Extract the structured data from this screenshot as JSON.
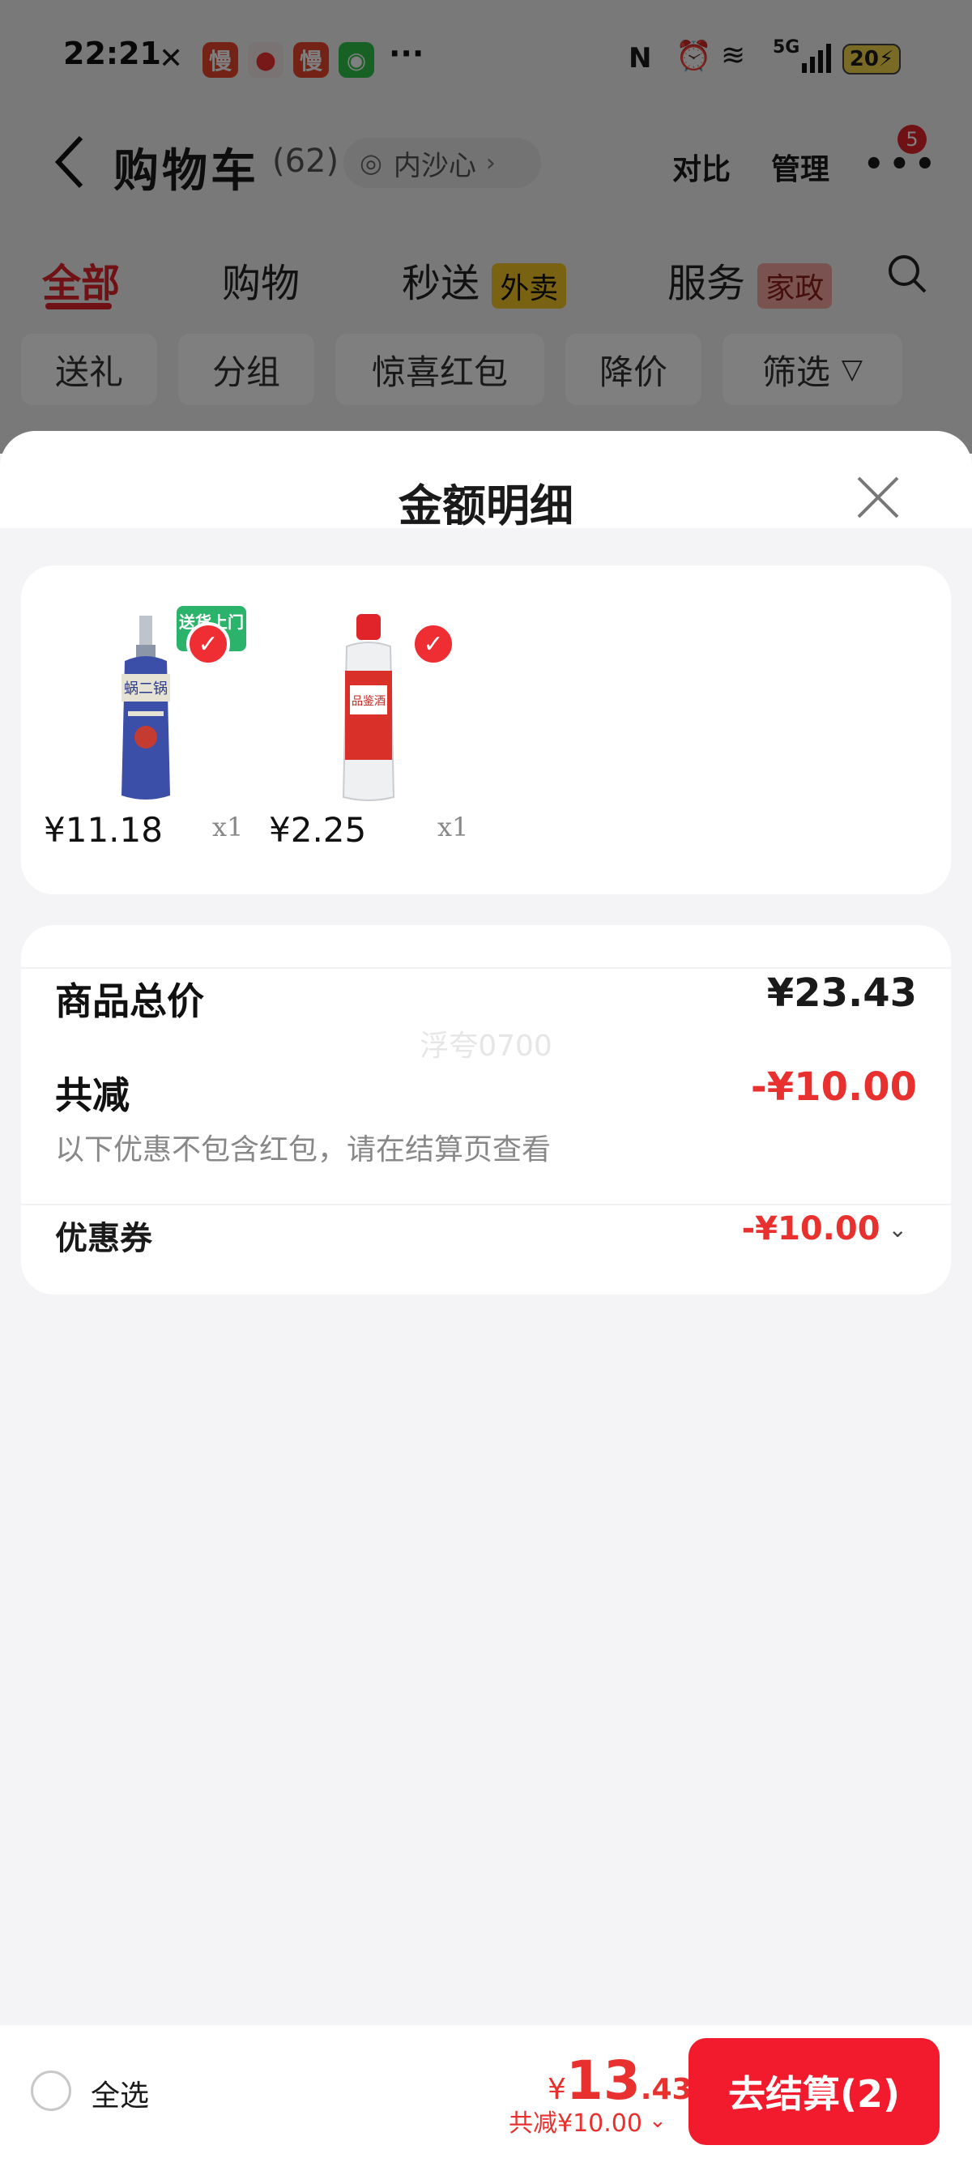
{
  "status_bar": {
    "time": "22:21",
    "battery": "20",
    "signal": "5G",
    "app_icon_text": "慢"
  },
  "header": {
    "back_icon": "chevron-left-icon",
    "title": "购物车",
    "count": "(62)",
    "address": "内沙心",
    "compare": "对比",
    "manage": "管理",
    "more_badge": "5"
  },
  "tabs": [
    {
      "label": "全部"
    },
    {
      "label": "购物"
    },
    {
      "label": "秒送",
      "tag": "外卖"
    },
    {
      "label": "服务",
      "tag": "家政"
    }
  ],
  "chips": [
    "送礼",
    "分组",
    "惊喜红包",
    "降价",
    "筛选"
  ],
  "sheet": {
    "title": "金额明细",
    "products": [
      {
        "price": "¥11.18",
        "qty": "x1",
        "badge": "送货上门",
        "bottle_label": "蜗二锅"
      },
      {
        "price": "¥2.25",
        "qty": "x1",
        "bottle_label": "品鉴酒"
      }
    ],
    "total_label": "商品总价",
    "total_value": "¥23.43",
    "discount_label": "共减",
    "discount_value": "-¥10.00",
    "discount_note": "以下优惠不包含红包，请在结算页查看",
    "coupon_label": "优惠券",
    "coupon_value": "-¥10.00",
    "watermark": "浮夸0700"
  },
  "bottom": {
    "select_all": "全选",
    "price_symbol": "¥",
    "price_int": "13",
    "price_dec": ".43",
    "saving": "共减¥10.00",
    "checkout": "去结算(2)"
  },
  "colors": {
    "accent": "#f21b2e",
    "price_red": "#e8312f"
  }
}
